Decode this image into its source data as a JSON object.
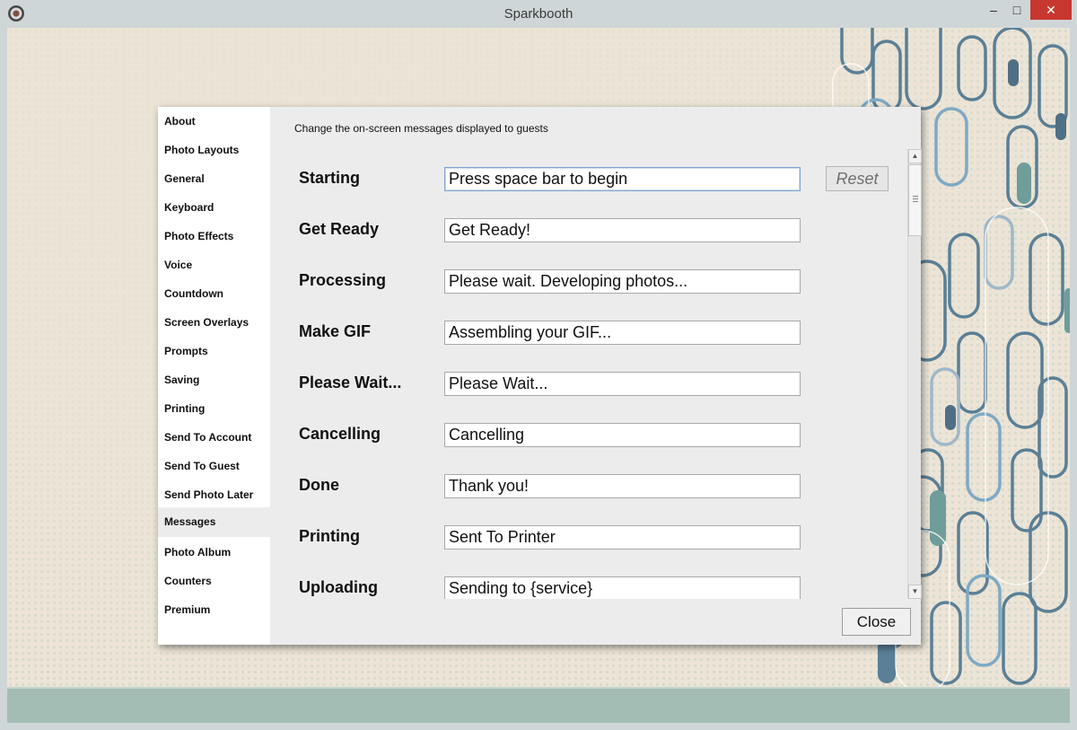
{
  "window": {
    "title": "Sparkbooth",
    "minimize_glyph": "–",
    "maximize_glyph": "□",
    "close_glyph": "✕"
  },
  "sidebar": {
    "items": [
      {
        "label": "About"
      },
      {
        "label": "Photo Layouts"
      },
      {
        "label": "General"
      },
      {
        "label": "Keyboard"
      },
      {
        "label": "Photo Effects"
      },
      {
        "label": "Voice"
      },
      {
        "label": "Countdown"
      },
      {
        "label": "Screen Overlays"
      },
      {
        "label": "Prompts"
      },
      {
        "label": "Saving"
      },
      {
        "label": "Printing"
      },
      {
        "label": "Send To Account"
      },
      {
        "label": "Send To Guest"
      },
      {
        "label": "Send Photo Later"
      },
      {
        "label": "Messages",
        "selected": true
      },
      {
        "label": "Photo Album"
      },
      {
        "label": "Counters"
      },
      {
        "label": "Premium"
      }
    ]
  },
  "panel": {
    "description": "Change the on-screen messages displayed to guests",
    "reset_label": "Reset",
    "close_label": "Close",
    "messages": [
      {
        "label": "Starting",
        "value": "Press space bar to begin",
        "focused": true
      },
      {
        "label": "Get Ready",
        "value": "Get Ready!"
      },
      {
        "label": "Processing",
        "value": "Please wait. Developing photos..."
      },
      {
        "label": "Make GIF",
        "value": "Assembling your GIF..."
      },
      {
        "label": "Please Wait...",
        "value": "Please Wait..."
      },
      {
        "label": "Cancelling",
        "value": "Cancelling"
      },
      {
        "label": "Done",
        "value": "Thank you!"
      },
      {
        "label": "Printing",
        "value": "Sent To Printer"
      },
      {
        "label": "Uploading",
        "value": "Sending to {service}"
      }
    ]
  },
  "scrollbar": {
    "up_glyph": "▲",
    "down_glyph": "▼"
  },
  "colors": {
    "accent_focus": "#7fa6cf",
    "footer_band": "#a3bdb5",
    "pattern_blue": "#5a7f96",
    "pattern_teal": "#6f9d9a"
  }
}
